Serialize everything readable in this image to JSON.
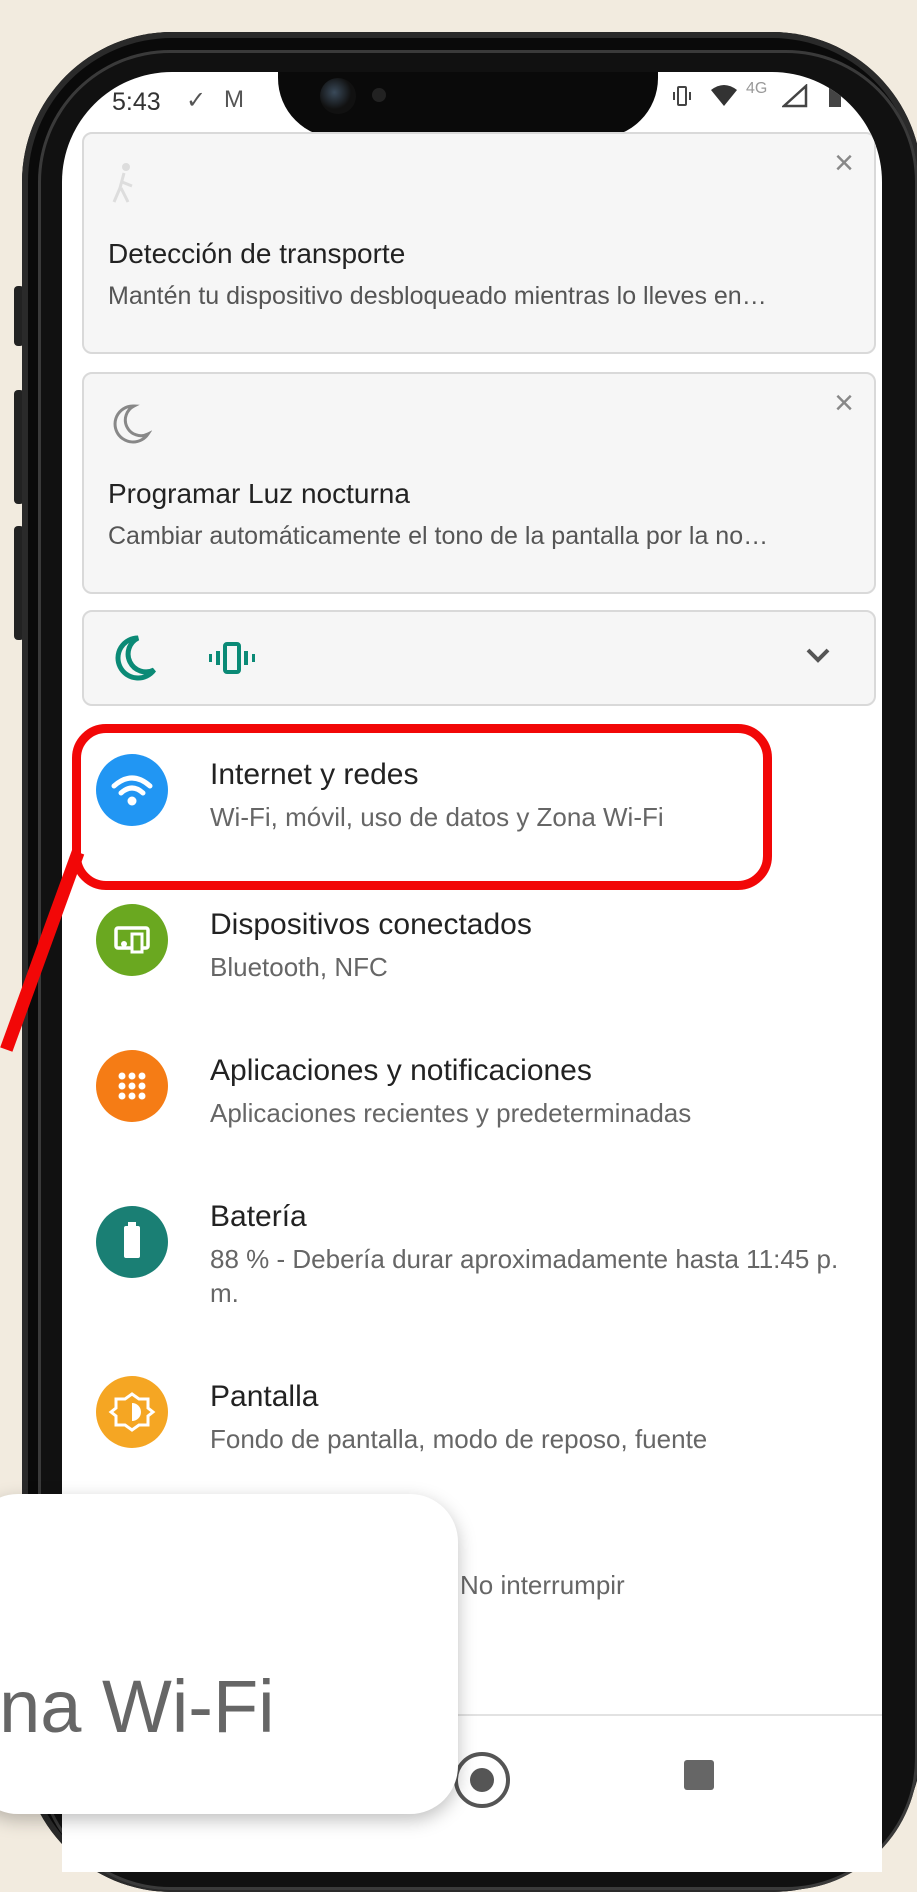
{
  "status": {
    "time": "5:43",
    "network": "4G"
  },
  "notifications": [
    {
      "title": "Detección de transporte",
      "text": "Mantén tu dispositivo desbloqueado mientras lo lleves en…",
      "icon": "walking-icon"
    },
    {
      "title": "Programar Luz nocturna",
      "text": "Cambiar automáticamente el tono de la pantalla por la no…",
      "icon": "moon-icon"
    }
  ],
  "settings": [
    {
      "title": "Internet y redes",
      "sub": "Wi-Fi, móvil, uso de datos y Zona Wi-Fi",
      "icon": "wifi-icon",
      "color": "#2196f3"
    },
    {
      "title": "Dispositivos conectados",
      "sub": "Bluetooth, NFC",
      "icon": "devices-icon",
      "color": "#6aa820"
    },
    {
      "title": "Aplicaciones y notificaciones",
      "sub": "Aplicaciones recientes y predeterminadas",
      "icon": "apps-grid-icon",
      "color": "#f57c15"
    },
    {
      "title": "Batería",
      "sub": "88 % - Debería durar aproximadamente hasta 11:45 p. m.",
      "icon": "battery-icon",
      "color": "#1a7f74"
    },
    {
      "title": "Pantalla",
      "sub": "Fondo de pantalla, modo de reposo, fuente",
      "icon": "brightness-icon",
      "color": "#f5a623"
    }
  ],
  "partial_sound_sub": "No interrumpir",
  "zoom_callout": "ona Wi-Fi",
  "colors": {
    "highlight": "#f20707",
    "teal": "#0b8a76"
  }
}
